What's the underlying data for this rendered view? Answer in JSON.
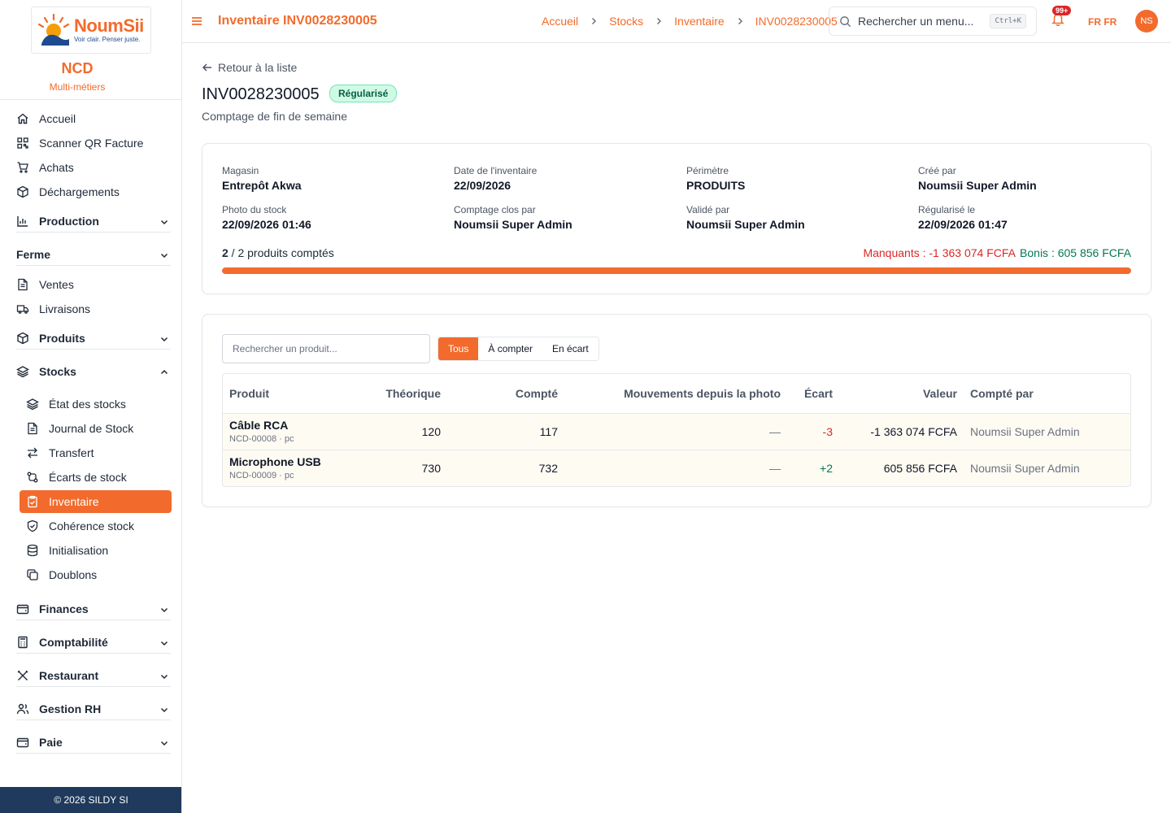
{
  "brand": {
    "logo_text": "NoumSii",
    "tagline": "Voir clair. Penser juste.",
    "org": "NCD",
    "org_sub": "Multi-métiers"
  },
  "nav": {
    "accueil": "Accueil",
    "scanner": "Scanner QR Facture",
    "achats": "Achats",
    "dechargements": "Déchargements",
    "production": "Production",
    "ferme": "Ferme",
    "ventes": "Ventes",
    "livraisons": "Livraisons",
    "produits": "Produits",
    "stocks": "Stocks",
    "stocks_items": [
      "État des stocks",
      "Journal de Stock",
      "Transfert",
      "Écarts de stock",
      "Inventaire",
      "Cohérence stock",
      "Initialisation",
      "Doublons"
    ],
    "finances": "Finances",
    "comptabilite": "Comptabilité",
    "restaurant": "Restaurant",
    "rh": "Gestion RH",
    "paie": "Paie"
  },
  "footer": "© 2026 SILDY SI",
  "header": {
    "title": "Inventaire INV0028230005",
    "breadcrumb": [
      "Accueil",
      "Stocks",
      "Inventaire",
      "INV0028230005"
    ],
    "search_placeholder": "Rechercher un menu...",
    "shortcut": "Ctrl+K",
    "notif_count": "99+",
    "lang": "FR FR",
    "avatar": "NS"
  },
  "page": {
    "back": "Retour à la liste",
    "code": "INV0028230005",
    "status": "Régularisé",
    "subtitle": "Comptage de fin de semaine"
  },
  "info": [
    {
      "label": "Magasin",
      "value": "Entrepôt Akwa"
    },
    {
      "label": "Date de l'inventaire",
      "value": "22/09/2026"
    },
    {
      "label": "Périmètre",
      "value": "PRODUITS"
    },
    {
      "label": "Créé par",
      "value": "Noumsii Super Admin"
    },
    {
      "label": "Photo du stock",
      "value": "22/09/2026 01:46"
    },
    {
      "label": "Comptage clos par",
      "value": "Noumsii Super Admin"
    },
    {
      "label": "Validé par",
      "value": "Noumsii Super Admin"
    },
    {
      "label": "Régularisé le",
      "value": "22/09/2026 01:47"
    }
  ],
  "progress": {
    "counted": "2",
    "rest": " / 2 produits comptés",
    "fraction": 1.0,
    "manquants": "Manquants : -1 363 074 FCFA",
    "bonis": "Bonis : 605 856 FCFA"
  },
  "table": {
    "search_placeholder": "Rechercher un produit...",
    "filters": [
      "Tous",
      "À compter",
      "En écart"
    ],
    "columns": [
      "Produit",
      "Théorique",
      "Compté",
      "Mouvements depuis la photo",
      "Écart",
      "Valeur",
      "Compté par"
    ],
    "rows": [
      {
        "name": "Câble RCA",
        "meta": "NCD-00008 · pc",
        "theorique": "120",
        "compte": "117",
        "mouvements": "—",
        "ecart": "-3",
        "valeur": "-1 363 074 FCFA",
        "par": "Noumsii Super Admin"
      },
      {
        "name": "Microphone USB",
        "meta": "NCD-00009 · pc",
        "theorique": "730",
        "compte": "732",
        "mouvements": "—",
        "ecart": "+2",
        "valeur": "605 856 FCFA",
        "par": "Noumsii Super Admin"
      }
    ]
  },
  "colors": {
    "accent": "#f26b2c",
    "negative": "#dc2626",
    "positive": "#047857",
    "footer": "#1f3a5c"
  }
}
